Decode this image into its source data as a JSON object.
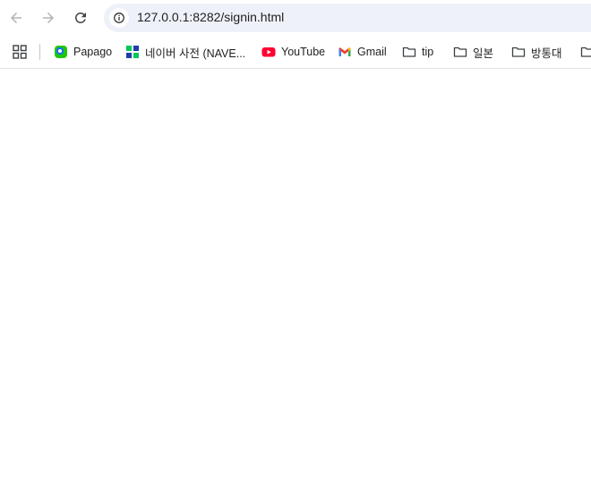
{
  "toolbar": {
    "back_icon": "arrow-left-icon",
    "forward_icon": "arrow-right-icon",
    "reload_icon": "reload-icon",
    "site_info_icon": "info-icon",
    "url": "127.0.0.1:8282/signin.html"
  },
  "bookmarks": {
    "apps_icon": "apps-grid-icon",
    "items": [
      {
        "label": "Papago",
        "icon": "papago-icon"
      },
      {
        "label": "네이버 사전 (NAVE...",
        "icon": "naver-dict-icon"
      },
      {
        "label": "YouTube",
        "icon": "youtube-icon"
      },
      {
        "label": "Gmail",
        "icon": "gmail-icon"
      },
      {
        "label": "tip",
        "icon": "folder-icon"
      },
      {
        "label": "일본",
        "icon": "folder-icon"
      },
      {
        "label": "방통대",
        "icon": "folder-icon"
      }
    ]
  },
  "colors": {
    "omnibox_bg": "#eef1f9",
    "youtube_red": "#ff0033",
    "papago_green": "#1ec800",
    "page_bg": "#ffffff"
  }
}
